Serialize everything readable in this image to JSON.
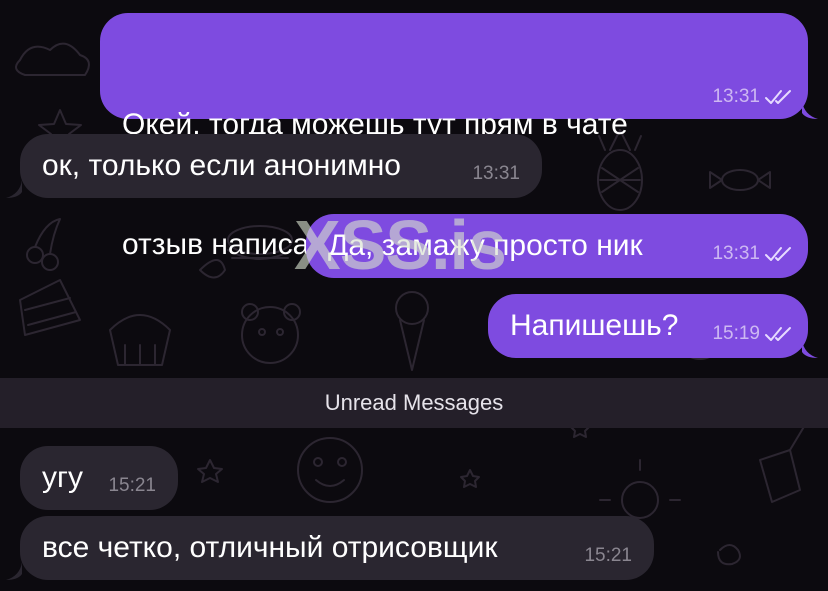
{
  "chat": {
    "messages": [
      {
        "direction": "outgoing",
        "lines": [
          "Окей, тогда можешь тут прям в чате",
          "отзыв написать? Заскриню просто )"
        ],
        "time": "13:31",
        "read": true
      },
      {
        "direction": "incoming",
        "text": "ок, только если анонимно",
        "time": "13:31"
      },
      {
        "direction": "outgoing",
        "text": "Да, замажу просто ник",
        "time": "13:31",
        "read": true
      },
      {
        "direction": "outgoing",
        "text": "Напишешь?",
        "time": "15:19",
        "read": true
      },
      {
        "direction": "incoming",
        "text": "угу",
        "time": "15:21"
      },
      {
        "direction": "incoming",
        "text": "все четко, отличный отрисовщик",
        "time": "15:21"
      }
    ],
    "unread_divider": "Unread Messages"
  },
  "watermark": {
    "text": "XSS.is",
    "color": "#d7e1cd"
  },
  "colors": {
    "background": "#0c0a0f",
    "outgoing_bubble": "#7e4be0",
    "incoming_bubble": "#2a2630",
    "unread_bar": "#241f29"
  },
  "icons": {
    "read_receipt": "double-check-icon"
  }
}
